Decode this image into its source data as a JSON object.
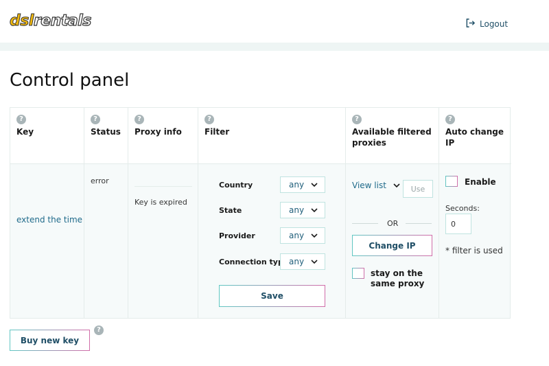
{
  "header": {
    "logo_part1": "dsl",
    "logo_part2": "rentals",
    "logout_label": "Logout"
  },
  "page": {
    "title": "Control panel"
  },
  "table": {
    "headers": {
      "key": "Key",
      "status": "Status",
      "proxy_info": "Proxy info",
      "filter": "Filter",
      "available_line1": "Available filtered",
      "available_line2": "proxies",
      "auto_change": "Auto change IP"
    },
    "help_glyph": "?",
    "row": {
      "key_link": "extend the time",
      "status": "error",
      "proxy_info": "Key is expired",
      "filter": {
        "country_label": "Country",
        "country_value": "any",
        "state_label": "State",
        "state_value": "any",
        "provider_label": "Provider",
        "provider_value": "any",
        "connection_label": "Connection type",
        "connection_value": "any",
        "save_label": "Save"
      },
      "available": {
        "view_list_label": "View list",
        "use_label": "Use",
        "or_label": "OR",
        "change_ip_label": "Change IP",
        "stay_line1": "stay on the",
        "stay_line2": "same proxy"
      },
      "auto_change": {
        "enable_label": "Enable",
        "seconds_label": "Seconds:",
        "seconds_value": "0",
        "filter_note": "* filter is used"
      }
    }
  },
  "footer": {
    "buy_key_label": "Buy new key"
  },
  "colors": {
    "accent_teal": "#5fc7c2",
    "accent_pink": "#d16ba8",
    "link_blue": "#1f6a8a",
    "logo_yellow": "#f2b90f"
  }
}
